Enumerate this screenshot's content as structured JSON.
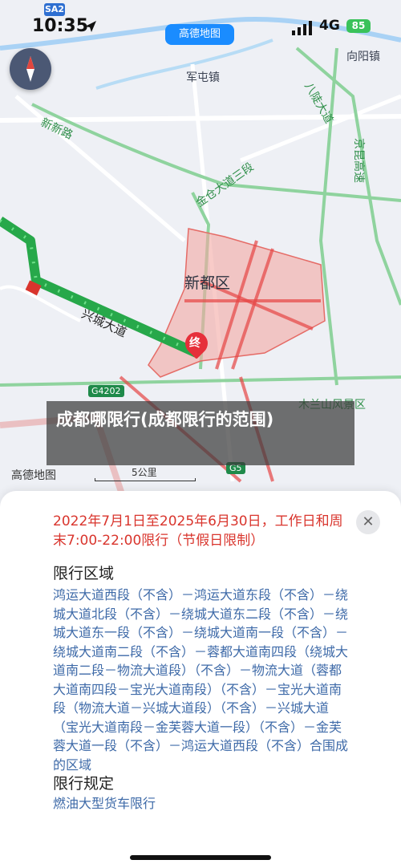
{
  "status_bar": {
    "time": "10:35",
    "network": "4G",
    "battery": "85"
  },
  "map": {
    "app_pill": "高德地图",
    "labels": {
      "sa2": "SA2",
      "juntun": "军屯镇",
      "xiangyang": "向阳镇",
      "xinxin_road": "新新路",
      "badu_road": "八陡大道",
      "jingkun": "京昆高速",
      "jingu_road": "金仓大道三段",
      "xindu": "新都区",
      "xingcheng": "兴城大道",
      "g4202": "G4202",
      "mulanshan": "木兰山风景区",
      "g5": "G5",
      "end_marker": "终"
    },
    "logo": "高德地图",
    "scale": "5公里"
  },
  "caption": "成都哪限行(成都限行的范围)",
  "panel": {
    "headline": "2022年7月1日至2025年6月30日，工作日和周末7:00-22:00限行（节假日限制）",
    "area_title": "限行区域",
    "area_body": "鸿运大道西段（不含）－鸿运大道东段（不含）－绕城大道北段（不含）－绕城大道东二段（不含）－绕城大道东一段（不含）－绕城大道南一段（不含）－绕城大道南二段（不含）－蓉都大道南四段（绕城大道南二段－物流大道段）（不含）－物流大道（蓉都大道南四段－宝光大道南段）（不含）－宝光大道南段（物流大道－兴城大道段）（不含）－兴城大道（宝光大道南段－金芙蓉大道一段）（不含）－金芙蓉大道一段（不含）－鸿运大道西段（不含）合围成的区域",
    "rule_title": "限行规定",
    "rule_body": "燃油大型货车限行"
  },
  "colors": {
    "restricted_zone": "#f4a9a4",
    "route": "#27a84a",
    "headline": "#d9352d",
    "link": "#3e6aa8"
  },
  "icons": [
    "location-arrow-icon",
    "signal-icon",
    "compass-icon",
    "close-icon",
    "end-marker-icon"
  ]
}
